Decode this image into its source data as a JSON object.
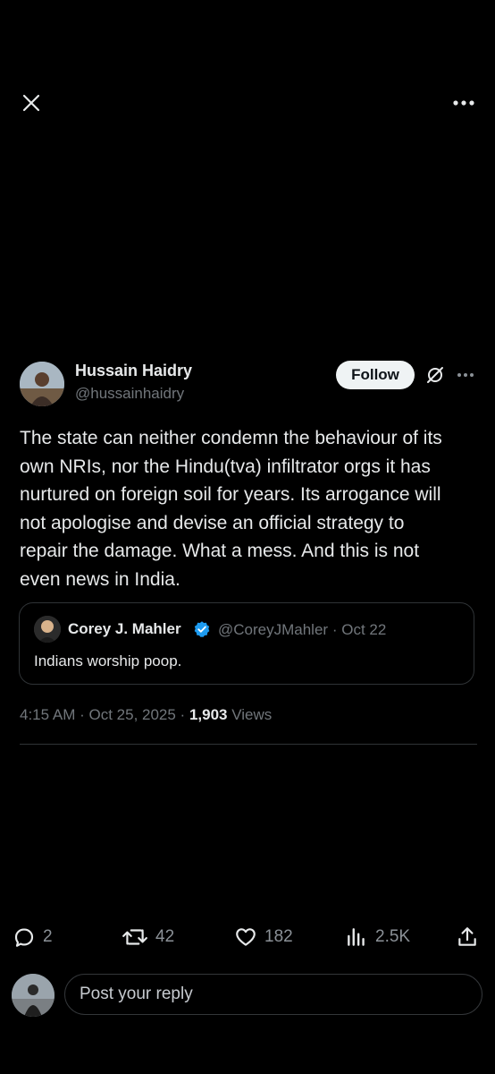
{
  "topbar": {
    "close_icon": "close-icon",
    "more_icon": "more-horizontal-icon"
  },
  "post": {
    "author_name": "Hussain Haidry",
    "author_handle": "@hussainhaidry",
    "follow_label": "Follow",
    "grok_icon": "grok-icon",
    "more_icon": "more-horizontal-icon",
    "text": "The state can neither condemn the behaviour of its\nown NRIs, nor the Hindu(tva) infiltrator orgs it has\nnurtured on foreign soil for years. Its arrogance will\nnot apologise and devise an official strategy to\nrepair the damage. What a mess. And this is not\neven news in India.",
    "quote": {
      "author_name": "Corey J. Mahler",
      "verified_icon": "verified-badge-icon",
      "author_handle": "@CoreyJMahler",
      "separator": "·",
      "date": "Oct 22",
      "text": "Indians worship poop."
    },
    "time": "4:15 AM",
    "date": "Oct 25, 2025",
    "views_count": "1,903",
    "views_label": "Views"
  },
  "actions": {
    "replies": "2",
    "reposts": "42",
    "likes": "182",
    "views": "2.5K"
  },
  "composer": {
    "placeholder": "Post your reply"
  },
  "colors": {
    "background": "#000000",
    "text_primary": "#e7e9ea",
    "text_secondary": "#71767b",
    "border": "#2f3336",
    "verified_blue": "#1d9bf0"
  }
}
